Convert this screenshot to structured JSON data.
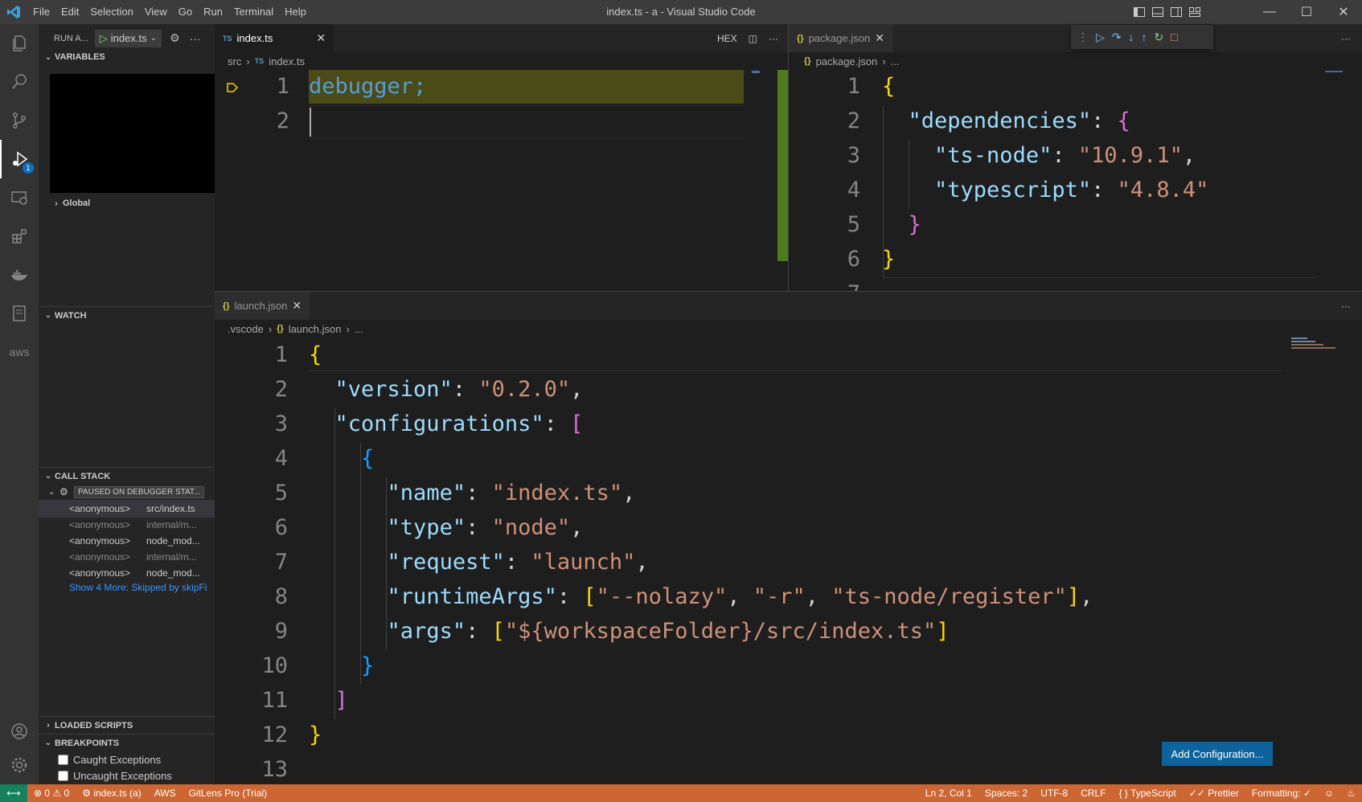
{
  "window": {
    "title": "index.ts - a - Visual Studio Code",
    "menu": [
      "File",
      "Edit",
      "Selection",
      "View",
      "Go",
      "Run",
      "Terminal",
      "Help"
    ]
  },
  "activity": {
    "items": [
      "explorer-icon",
      "search-icon",
      "source-control-icon",
      "run-debug-icon",
      "remote-explorer-icon",
      "extensions-icon",
      "docker-icon",
      "notebook-icon",
      "aws-icon"
    ],
    "debug_badge": "1",
    "aws_label": "aws",
    "bottom": [
      "accounts-icon",
      "manage-gear-icon"
    ]
  },
  "sidebar": {
    "run_label": "RUN A...",
    "config_name": "index.ts",
    "variables_title": "VARIABLES",
    "global_label": "Global",
    "watch_title": "WATCH",
    "callstack_title": "CALL STACK",
    "paused_badge": "PAUSED ON DEBUGGER STAT...",
    "stack": [
      {
        "fn": "<anonymous>",
        "src": "src/index.ts"
      },
      {
        "fn": "<anonymous>",
        "src": "internal/m..."
      },
      {
        "fn": "<anonymous>",
        "src": "node_mod..."
      },
      {
        "fn": "<anonymous>",
        "src": "internal/m..."
      },
      {
        "fn": "<anonymous>",
        "src": "node_mod..."
      }
    ],
    "show_more": "Show 4 More: Skipped by skipFi",
    "loaded_scripts_title": "LOADED SCRIPTS",
    "breakpoints_title": "BREAKPOINTS",
    "caught": "Caught Exceptions",
    "uncaught": "Uncaught Exceptions"
  },
  "editor1": {
    "tab_icon": "TS",
    "tab_label": "index.ts",
    "hex_label": "HEX",
    "breadcrumb": [
      "src",
      "index.ts"
    ],
    "line_numbers": [
      "1",
      "2"
    ],
    "line1": "debugger;"
  },
  "editor2": {
    "tab_label": "package.json",
    "breadcrumb_file": "package.json",
    "breadcrumb_more": "...",
    "line_numbers": [
      "1",
      "2",
      "3",
      "4",
      "5",
      "6",
      "7"
    ],
    "k_dependencies": "\"dependencies\"",
    "k_tsnode": "\"ts-node\"",
    "v_tsnode": "\"10.9.1\"",
    "k_typescript": "\"typescript\"",
    "v_typescript": "\"4.8.4\""
  },
  "editor3": {
    "tab_label": "launch.json",
    "breadcrumb_dir": ".vscode",
    "breadcrumb_file": "launch.json",
    "breadcrumb_more": "...",
    "line_numbers": [
      "1",
      "2",
      "3",
      "4",
      "5",
      "6",
      "7",
      "8",
      "9",
      "10",
      "11",
      "12",
      "13"
    ],
    "k_version": "\"version\"",
    "v_version": "\"0.2.0\"",
    "k_configurations": "\"configurations\"",
    "k_name": "\"name\"",
    "v_name": "\"index.ts\"",
    "k_type": "\"type\"",
    "v_type": "\"node\"",
    "k_request": "\"request\"",
    "v_request": "\"launch\"",
    "k_runtimeArgs": "\"runtimeArgs\"",
    "v_ra1": "\"--nolazy\"",
    "v_ra2": "\"-r\"",
    "v_ra3": "\"ts-node/register\"",
    "k_args": "\"args\"",
    "v_args": "\"${workspaceFolder}/src/index.ts\"",
    "add_config": "Add Configuration..."
  },
  "status": {
    "errors": "0",
    "warnings": "0",
    "debug_target": "index.ts (a)",
    "aws": "AWS",
    "gitlens": "GitLens Pro (Trial)",
    "position": "Ln 2, Col 1",
    "spaces": "Spaces: 2",
    "encoding": "UTF-8",
    "eol": "CRLF",
    "language": "TypeScript",
    "prettier": "Prettier",
    "formatting": "Formatting: ✓"
  },
  "colors": {
    "statusbar": "#cc6633",
    "remote": "#16825d",
    "accent": "#0e639c"
  }
}
